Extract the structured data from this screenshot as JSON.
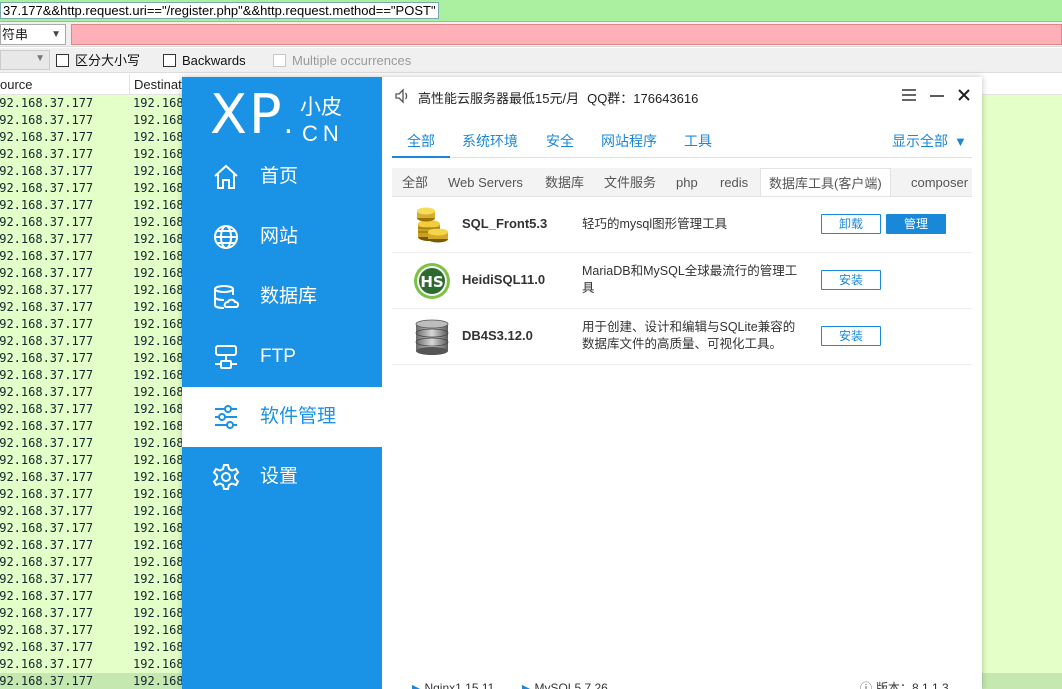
{
  "background": {
    "filter_text": "37.177&&http.request.uri==\"/register.php\"&&http.request.method==\"POST\"",
    "search_type": "符串",
    "options": [
      {
        "label": "区分大小写",
        "enabled": true
      },
      {
        "label": "Backwards",
        "enabled": true
      },
      {
        "label": "Multiple occurrences",
        "enabled": false
      }
    ],
    "columns": {
      "source": "ource",
      "destination": "Destinat"
    },
    "row_source": "192.168.37.177",
    "row_destination": "192.168",
    "row_count": 35,
    "colors": {
      "filter_bg": "#aaf0a0",
      "search_bg": "#ffafb8",
      "row_bg": "#e4ffc7"
    }
  },
  "app": {
    "logo": {
      "main": "XP",
      "dot": ".",
      "zh": "小皮",
      "en": "CN"
    },
    "nav": [
      {
        "label": "首页",
        "icon": "home-icon",
        "active": false
      },
      {
        "label": "网站",
        "icon": "globe-icon",
        "active": false
      },
      {
        "label": "数据库",
        "icon": "database-icon",
        "active": false
      },
      {
        "label": "FTP",
        "icon": "ftp-icon",
        "active": false
      },
      {
        "label": "软件管理",
        "icon": "sliders-icon",
        "active": true
      },
      {
        "label": "设置",
        "icon": "gear-icon",
        "active": false
      }
    ],
    "notice": "高性能云服务器最低15元/月",
    "qq": "QQ群：176643616",
    "category_tabs": [
      {
        "label": "全部",
        "active": true
      },
      {
        "label": "系统环境",
        "active": false
      },
      {
        "label": "安全",
        "active": false
      },
      {
        "label": "网站程序",
        "active": false
      },
      {
        "label": "工具",
        "active": false
      }
    ],
    "show_all": "显示全部",
    "sub_tabs": [
      {
        "label": "全部",
        "active": false
      },
      {
        "label": "Web Servers",
        "active": false
      },
      {
        "label": "数据库",
        "active": false
      },
      {
        "label": "文件服务",
        "active": false
      },
      {
        "label": "php",
        "active": false
      },
      {
        "label": "redis",
        "active": false
      },
      {
        "label": "数据库工具(客户端)",
        "active": true
      },
      {
        "label": "composer",
        "active": false
      }
    ],
    "software": [
      {
        "name": "SQL_Front5.3",
        "desc": "轻巧的mysql图形管理工具",
        "icon": "coins-icon",
        "buttons": [
          "卸载",
          "管理"
        ]
      },
      {
        "name": "HeidiSQL11.0",
        "desc": "MariaDB和MySQL全球最流行的管理工具",
        "icon": "hs-logo-icon",
        "buttons": [
          "安装"
        ]
      },
      {
        "name": "DB4S3.12.0",
        "desc": "用于创建、设计和编辑与SQLite兼容的数据库文件的高质量、可视化工具。",
        "icon": "database-stack-icon",
        "buttons": [
          "安装"
        ]
      }
    ],
    "status": {
      "nginx": "Nginx1.15.11",
      "mysql": "MySQL5.7.26",
      "version": "版本：8.1.1.3"
    },
    "colors": {
      "accent": "#1a92e6",
      "link": "#1a88d8"
    }
  }
}
